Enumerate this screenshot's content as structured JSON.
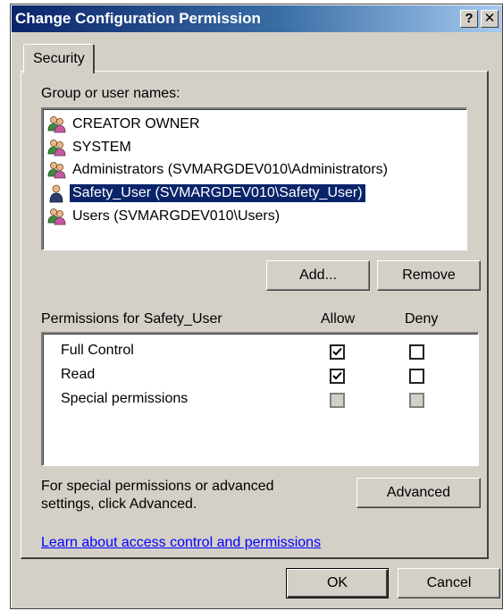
{
  "window": {
    "title": "Change Configuration Permission",
    "help_label": "?",
    "close_label": "✕"
  },
  "tabs": [
    {
      "label": "Security",
      "selected": true
    }
  ],
  "users_section": {
    "label": "Group or user names:",
    "items": [
      {
        "label": "CREATOR OWNER",
        "icon": "group-icon",
        "selected": false
      },
      {
        "label": "SYSTEM",
        "icon": "group-icon",
        "selected": false
      },
      {
        "label": "Administrators (SVMARGDEV010\\Administrators)",
        "icon": "group-icon",
        "selected": false
      },
      {
        "label": "Safety_User (SVMARGDEV010\\Safety_User)",
        "icon": "user-icon",
        "selected": true
      },
      {
        "label": "Users (SVMARGDEV010\\Users)",
        "icon": "group-icon",
        "selected": false
      }
    ],
    "add_label": "Add...",
    "remove_label": "Remove"
  },
  "permissions": {
    "header": "Permissions for Safety_User",
    "allow_header": "Allow",
    "deny_header": "Deny",
    "rows": [
      {
        "label": "Full Control",
        "allow": true,
        "deny": false,
        "disabled": false
      },
      {
        "label": "Read",
        "allow": true,
        "deny": false,
        "disabled": false
      },
      {
        "label": "Special permissions",
        "allow": false,
        "deny": false,
        "disabled": true
      }
    ]
  },
  "advanced": {
    "text": "For special permissions or advanced settings, click Advanced.",
    "button_label": "Advanced"
  },
  "link": {
    "label": "Learn about access control and permissions"
  },
  "footer": {
    "ok_label": "OK",
    "cancel_label": "Cancel"
  },
  "colors": {
    "titlebar_start": "#0a246a",
    "titlebar_end": "#a6caf0",
    "dialog_face": "#d4d0c8",
    "selection": "#0a246a",
    "link": "#0000ff"
  }
}
